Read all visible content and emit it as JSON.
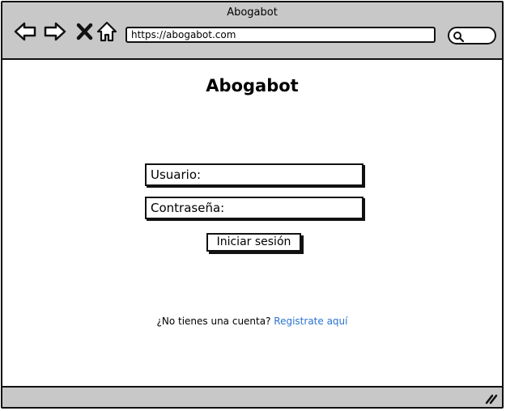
{
  "window": {
    "title": "Abogabot"
  },
  "toolbar": {
    "back_icon": "arrow-left-icon",
    "forward_icon": "arrow-right-icon",
    "close_icon": "x-icon",
    "home_icon": "home-icon",
    "url": "https://abogabot.com",
    "search_icon": "search-icon"
  },
  "page": {
    "title": "Abogabot",
    "username_label": "Usuario:",
    "password_label": "Contraseña:",
    "login_button": "Iniciar sesión",
    "signup_prompt": "¿No tienes una cuenta?",
    "signup_link": "Registrate aquí"
  },
  "colors": {
    "chrome": "#c8c8c8",
    "link": "#2a73d0",
    "border": "#111111"
  }
}
